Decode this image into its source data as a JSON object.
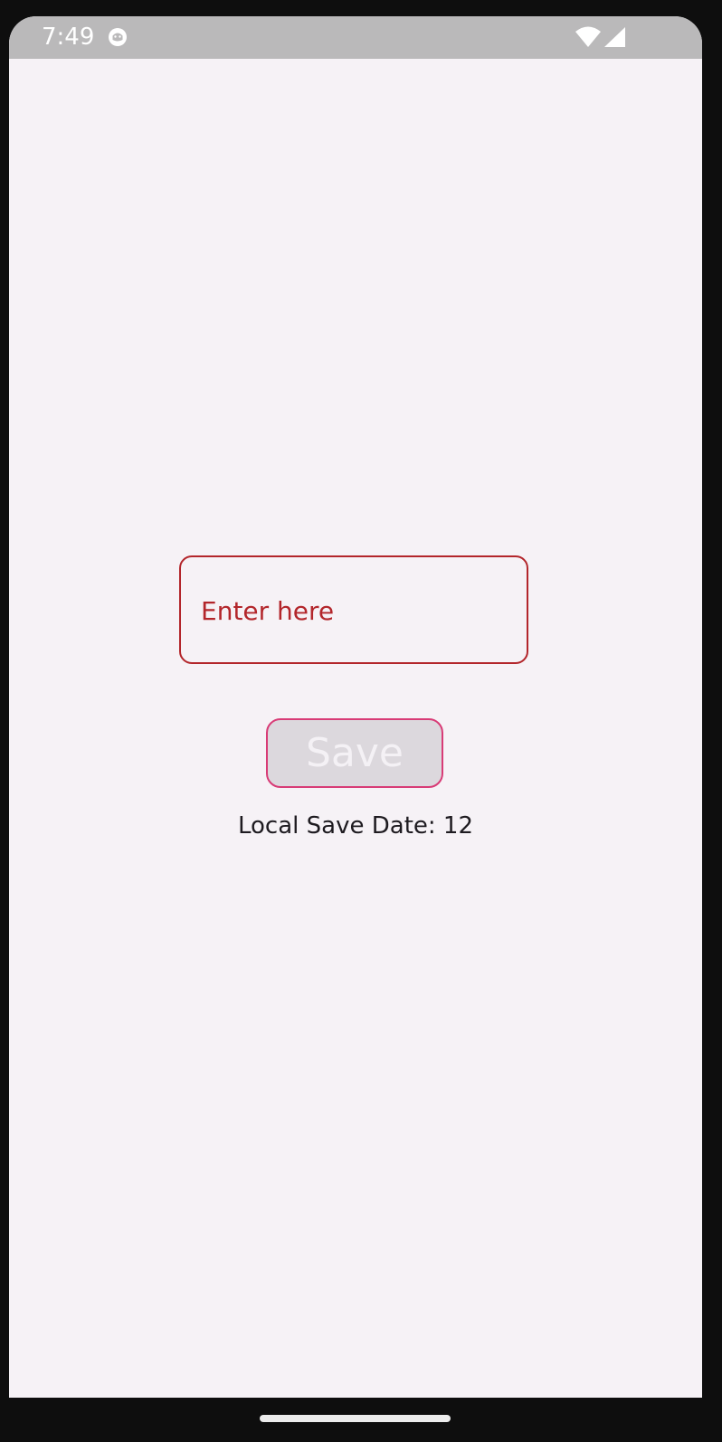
{
  "status_bar": {
    "time": "7:49",
    "app_icon": "android-debug-icon",
    "wifi_icon": "wifi-icon",
    "signal_icon": "cellular-signal-icon"
  },
  "form": {
    "input_placeholder": "Enter here",
    "input_value": "",
    "save_label": "Save",
    "save_date_text": "Local Save Date: 12"
  },
  "colors": {
    "screen_background": "#f6f2f6",
    "status_bar": "#bab9ba",
    "input_border": "#b3262b",
    "button_border": "#d83b76",
    "button_fill": "#dcd8dd"
  }
}
